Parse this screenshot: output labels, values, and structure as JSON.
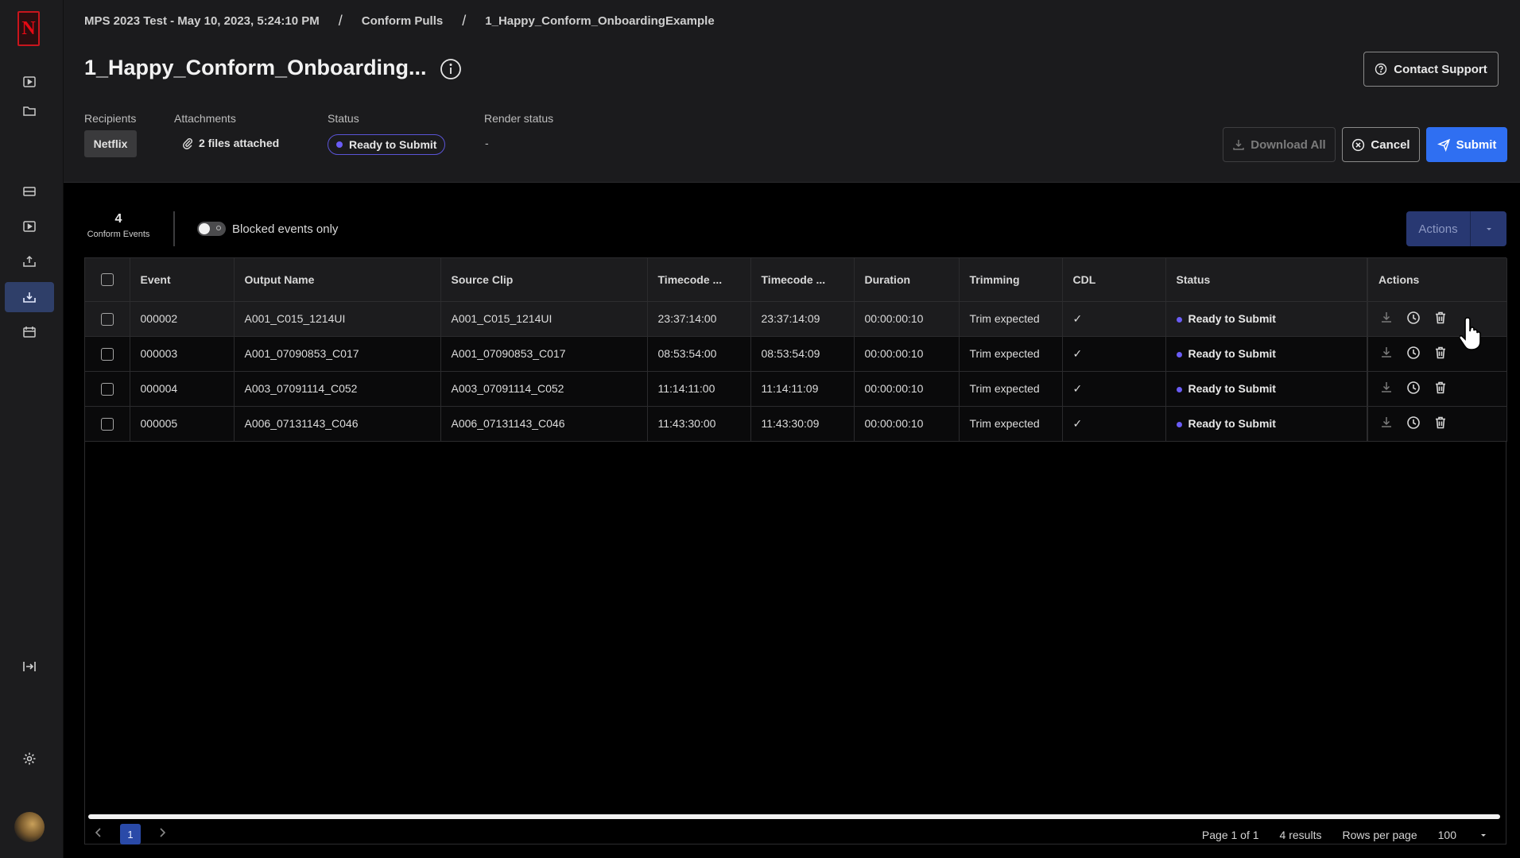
{
  "sidebar": {
    "logo_letter": "N",
    "items": [
      {
        "icon": "play-square-icon"
      },
      {
        "icon": "folder-icon"
      },
      {
        "icon": "storage-icon"
      },
      {
        "icon": "media-icon"
      },
      {
        "icon": "upload-tray-icon"
      },
      {
        "icon": "download-tray-icon",
        "active": true
      },
      {
        "icon": "calendar-icon"
      }
    ],
    "collapse_icon": "collapse-sidebar-icon",
    "settings_icon": "gear-icon"
  },
  "breadcrumb": [
    "MPS 2023 Test - May 10, 2023, 5:24:10 PM",
    "Conform Pulls",
    "1_Happy_Conform_OnboardingExample"
  ],
  "breadcrumb_sep": "/",
  "title": "1_Happy_Conform_Onboarding...",
  "contact_support": "Contact Support",
  "meta": {
    "recipients_label": "Recipients",
    "recipients_value": "Netflix",
    "attachments_label": "Attachments",
    "attachments_value": "2 files attached",
    "status_label": "Status",
    "status_value": "Ready to Submit",
    "render_label": "Render status",
    "render_value": "-"
  },
  "buttons": {
    "download_all": "Download All",
    "cancel": "Cancel",
    "submit": "Submit",
    "actions": "Actions"
  },
  "summary": {
    "count": "4",
    "count_label": "Conform Events",
    "toggle_label": "Blocked events only"
  },
  "table": {
    "columns": [
      "Event",
      "Output Name",
      "Source Clip",
      "Timecode ...",
      "Timecode ...",
      "Duration",
      "Trimming",
      "CDL",
      "Status",
      "Actions"
    ],
    "rows": [
      {
        "event": "000002",
        "output": "A001_C015_1214UI",
        "source": "A001_C015_1214UI",
        "tc_in": "23:37:14:00",
        "tc_out": "23:37:14:09",
        "duration": "00:00:00:10",
        "trimming": "Trim expected",
        "cdl": "✓",
        "status": "Ready to Submit"
      },
      {
        "event": "000003",
        "output": "A001_07090853_C017",
        "source": "A001_07090853_C017",
        "tc_in": "08:53:54:00",
        "tc_out": "08:53:54:09",
        "duration": "00:00:00:10",
        "trimming": "Trim expected",
        "cdl": "✓",
        "status": "Ready to Submit"
      },
      {
        "event": "000004",
        "output": "A003_07091114_C052",
        "source": "A003_07091114_C052",
        "tc_in": "11:14:11:00",
        "tc_out": "11:14:11:09",
        "duration": "00:00:00:10",
        "trimming": "Trim expected",
        "cdl": "✓",
        "status": "Ready to Submit"
      },
      {
        "event": "000005",
        "output": "A006_07131143_C046",
        "source": "A006_07131143_C046",
        "tc_in": "11:43:30:00",
        "tc_out": "11:43:30:09",
        "duration": "00:00:00:10",
        "trimming": "Trim expected",
        "cdl": "✓",
        "status": "Ready to Submit"
      }
    ]
  },
  "pagination": {
    "current_page": "1",
    "page_info": "Page 1 of 1",
    "results": "4 results",
    "rows_per_page_label": "Rows per page",
    "rows_per_page": "100"
  },
  "colors": {
    "accent": "#2f6ff2",
    "status_dot": "#6a5cf5",
    "brand_red": "#e50914"
  }
}
